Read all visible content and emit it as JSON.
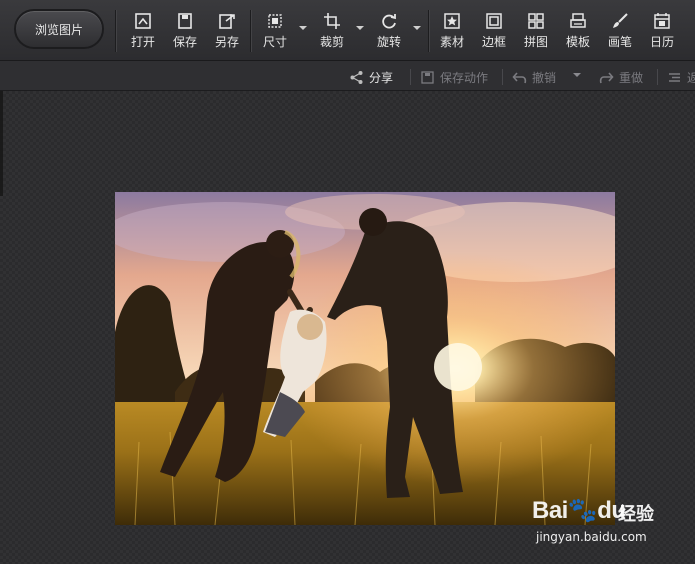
{
  "toolbar": {
    "browse_label": "浏览图片",
    "tools": [
      {
        "label": "打开",
        "icon": "open-icon"
      },
      {
        "label": "保存",
        "icon": "save-icon"
      },
      {
        "label": "另存",
        "icon": "save-as-icon"
      },
      {
        "label": "尺寸",
        "icon": "resize-icon"
      },
      {
        "label": "裁剪",
        "icon": "crop-icon"
      },
      {
        "label": "旋转",
        "icon": "rotate-icon"
      },
      {
        "label": "素材",
        "icon": "material-icon"
      },
      {
        "label": "边框",
        "icon": "border-icon"
      },
      {
        "label": "拼图",
        "icon": "collage-icon"
      },
      {
        "label": "模板",
        "icon": "template-icon"
      },
      {
        "label": "画笔",
        "icon": "brush-icon"
      },
      {
        "label": "日历",
        "icon": "calendar-icon"
      }
    ]
  },
  "subbar": {
    "share": "分享",
    "save_action": "保存动作",
    "undo": "撤销",
    "redo": "重做",
    "last": "返"
  },
  "watermark": {
    "logo": "Bai",
    "logo_tail": "du",
    "jingyan": "经验",
    "url": "jingyan.baidu.com"
  }
}
